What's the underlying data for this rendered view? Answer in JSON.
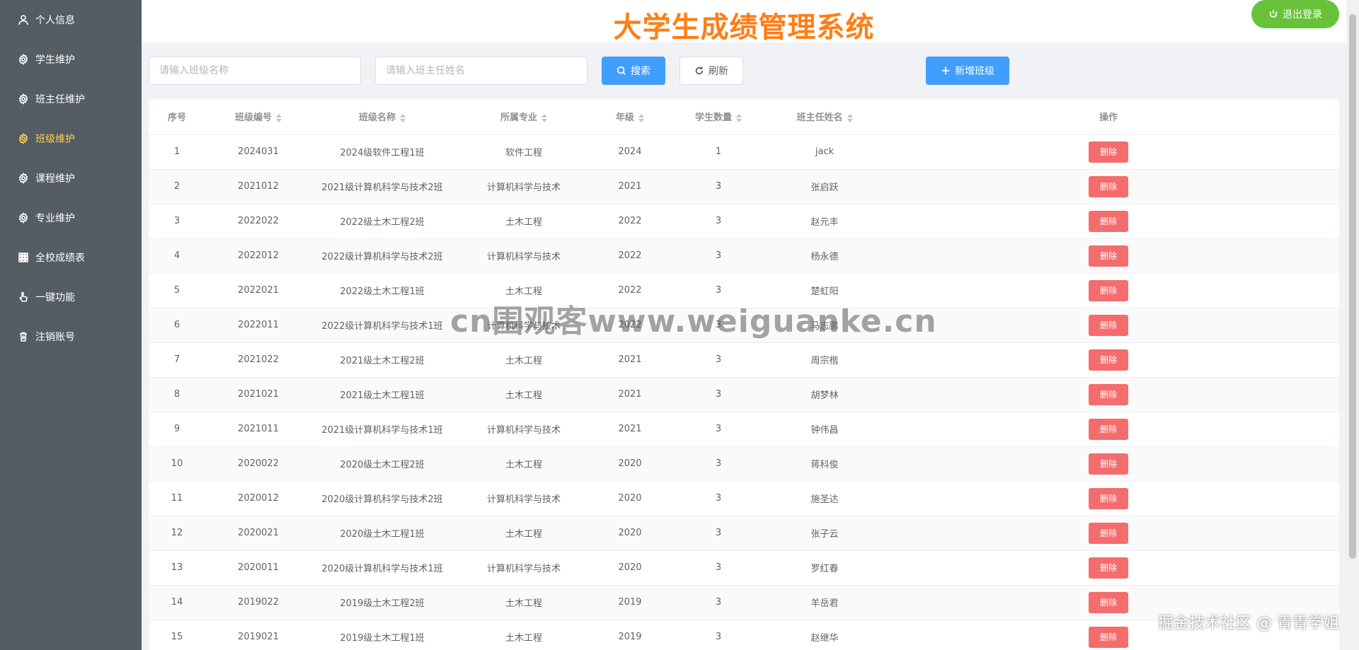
{
  "sidebar": {
    "items": [
      {
        "label": "个人信息",
        "icon": "user-icon",
        "active": false
      },
      {
        "label": "学生维护",
        "icon": "gear-icon",
        "active": false
      },
      {
        "label": "班主任维护",
        "icon": "gear-icon",
        "active": false
      },
      {
        "label": "班级维护",
        "icon": "gear-icon",
        "active": true
      },
      {
        "label": "课程维护",
        "icon": "gear-icon",
        "active": false
      },
      {
        "label": "专业维护",
        "icon": "gear-icon",
        "active": false
      },
      {
        "label": "全校成绩表",
        "icon": "grid-icon",
        "active": false
      },
      {
        "label": "一键功能",
        "icon": "pointer-icon",
        "active": false
      },
      {
        "label": "注销账号",
        "icon": "trash-icon",
        "active": false
      }
    ]
  },
  "header": {
    "title": "大学生成绩管理系统",
    "logout_label": "退出登录"
  },
  "toolbar": {
    "class_name_placeholder": "请输入班级名称",
    "teacher_name_placeholder": "请输入班主任姓名",
    "search_label": "搜索",
    "refresh_label": "刷新",
    "add_label": "新增班级"
  },
  "table": {
    "columns": [
      "序号",
      "班级编号",
      "班级名称",
      "所属专业",
      "年级",
      "学生数量",
      "班主任姓名",
      "操作"
    ],
    "delete_label": "删除",
    "rows": [
      [
        "1",
        "2024031",
        "2024级软件工程1班",
        "软件工程",
        "2024",
        "1",
        "jack"
      ],
      [
        "2",
        "2021012",
        "2021级计算机科学与技术2班",
        "计算机科学与技术",
        "2021",
        "3",
        "张启跃"
      ],
      [
        "3",
        "2022022",
        "2022级土木工程2班",
        "土木工程",
        "2022",
        "3",
        "赵元丰"
      ],
      [
        "4",
        "2022012",
        "2022级计算机科学与技术2班",
        "计算机科学与技术",
        "2022",
        "3",
        "杨永德"
      ],
      [
        "5",
        "2022021",
        "2022级土木工程1班",
        "土木工程",
        "2022",
        "3",
        "楚虹阳"
      ],
      [
        "6",
        "2022011",
        "2022级计算机科学与技术1班",
        "计算机科学与技术",
        "2022",
        "3",
        "马志鹏"
      ],
      [
        "7",
        "2021022",
        "2021级土木工程2班",
        "土木工程",
        "2021",
        "3",
        "周宗楷"
      ],
      [
        "8",
        "2021021",
        "2021级土木工程1班",
        "土木工程",
        "2021",
        "3",
        "胡梦林"
      ],
      [
        "9",
        "2021011",
        "2021级计算机科学与技术1班",
        "计算机科学与技术",
        "2021",
        "3",
        "钟伟昌"
      ],
      [
        "10",
        "2020022",
        "2020级土木工程2班",
        "土木工程",
        "2020",
        "3",
        "蒋科俊"
      ],
      [
        "11",
        "2020012",
        "2020级计算机科学与技术2班",
        "计算机科学与技术",
        "2020",
        "3",
        "施圣达"
      ],
      [
        "12",
        "2020021",
        "2020级土木工程1班",
        "土木工程",
        "2020",
        "3",
        "张子云"
      ],
      [
        "13",
        "2020011",
        "2020级计算机科学与技术1班",
        "计算机科学与技术",
        "2020",
        "3",
        "罗红春"
      ],
      [
        "14",
        "2019022",
        "2019级土木工程2班",
        "土木工程",
        "2019",
        "3",
        "羊岳君"
      ],
      [
        "15",
        "2019021",
        "2019级土木工程1班",
        "土木工程",
        "2019",
        "3",
        "赵继华"
      ]
    ]
  },
  "watermark": {
    "text": "cn围观客www.weiguanke.cn",
    "corner": "掘金技术社区 @ 青青学姐"
  },
  "colors": {
    "sidebar_bg": "#545c64",
    "active_menu": "#ffd04b",
    "title": "#ff7e14",
    "primary": "#409eff",
    "success": "#67c23a",
    "danger": "#f56c6c"
  }
}
